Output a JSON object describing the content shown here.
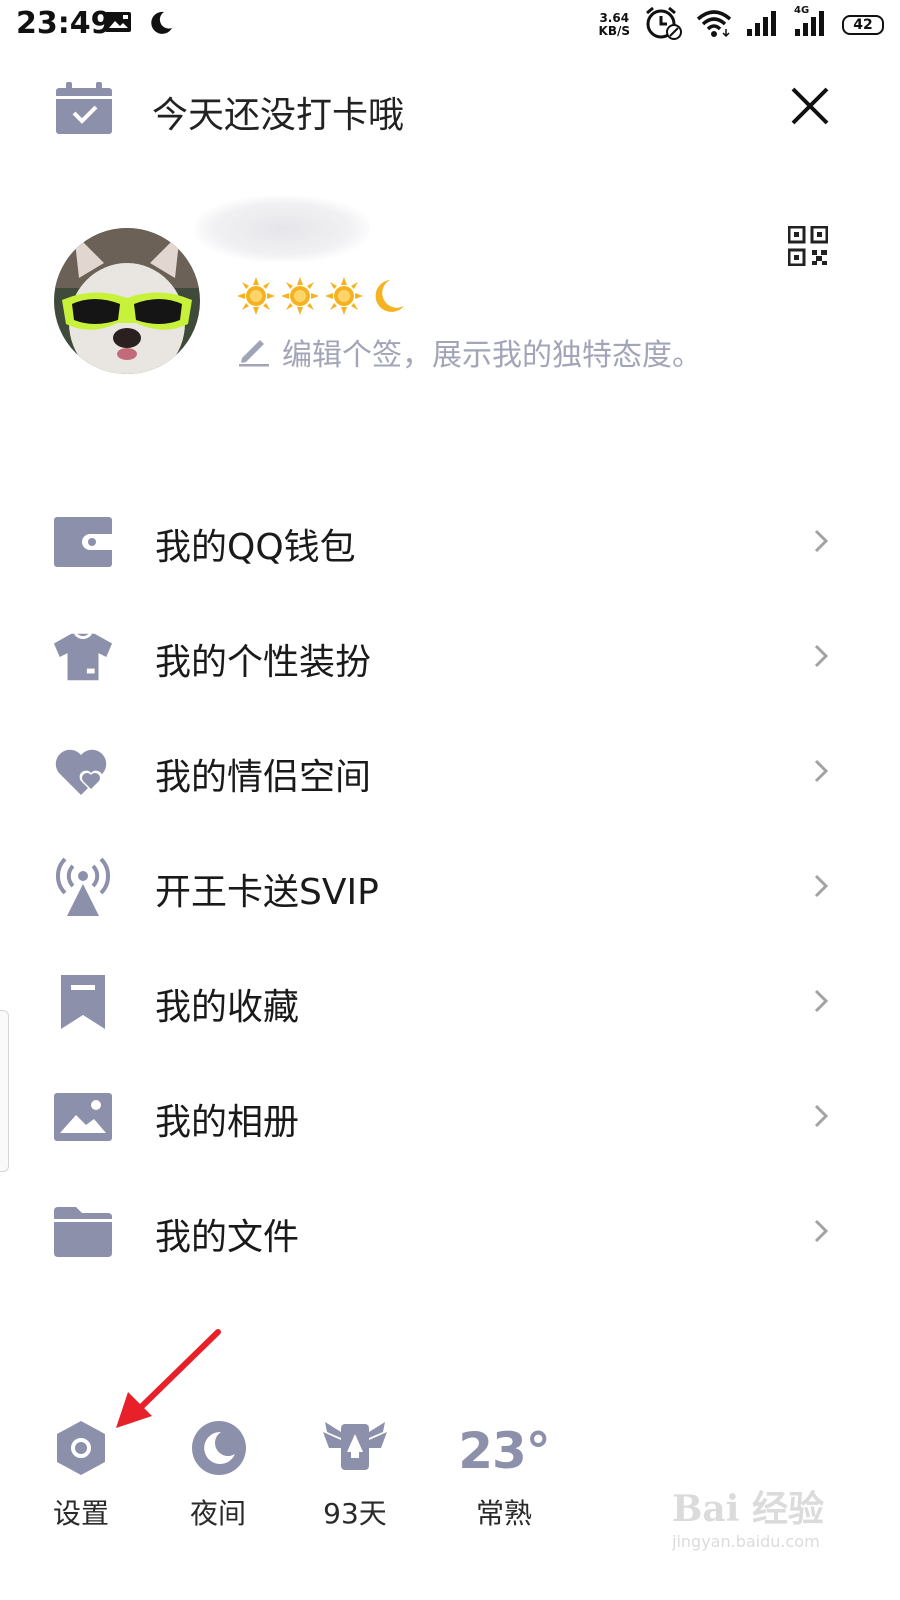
{
  "status_bar": {
    "time": "23:49",
    "net_speed_value": "3.64",
    "net_speed_unit": "KB/S",
    "network_type": "4G",
    "battery": "42"
  },
  "checkin": {
    "text": "今天还没打卡哦"
  },
  "profile": {
    "signature_placeholder": "编辑个签，展示我的独特态度。"
  },
  "menu": {
    "items": [
      {
        "label": "我的QQ钱包",
        "icon": "wallet-icon"
      },
      {
        "label": "我的个性装扮",
        "icon": "tshirt-icon"
      },
      {
        "label": "我的情侣空间",
        "icon": "hearts-icon"
      },
      {
        "label": "开王卡送SVIP",
        "icon": "signal-tower-icon"
      },
      {
        "label": "我的收藏",
        "icon": "bookmark-icon"
      },
      {
        "label": "我的相册",
        "icon": "photo-icon"
      },
      {
        "label": "我的文件",
        "icon": "folder-icon"
      }
    ]
  },
  "bottom_bar": {
    "settings_label": "设置",
    "night_label": "夜间",
    "days_label": "93天",
    "temperature": "23°",
    "city": "常熟"
  },
  "watermark": {
    "main": "Bai 经验",
    "sub": "jingyan.baidu.com"
  },
  "colors": {
    "icon_gray": "#8d90ab",
    "signature_gray": "#a2a5b8",
    "arrow_red": "#e8202a",
    "sun_gold": "#f5b322"
  }
}
